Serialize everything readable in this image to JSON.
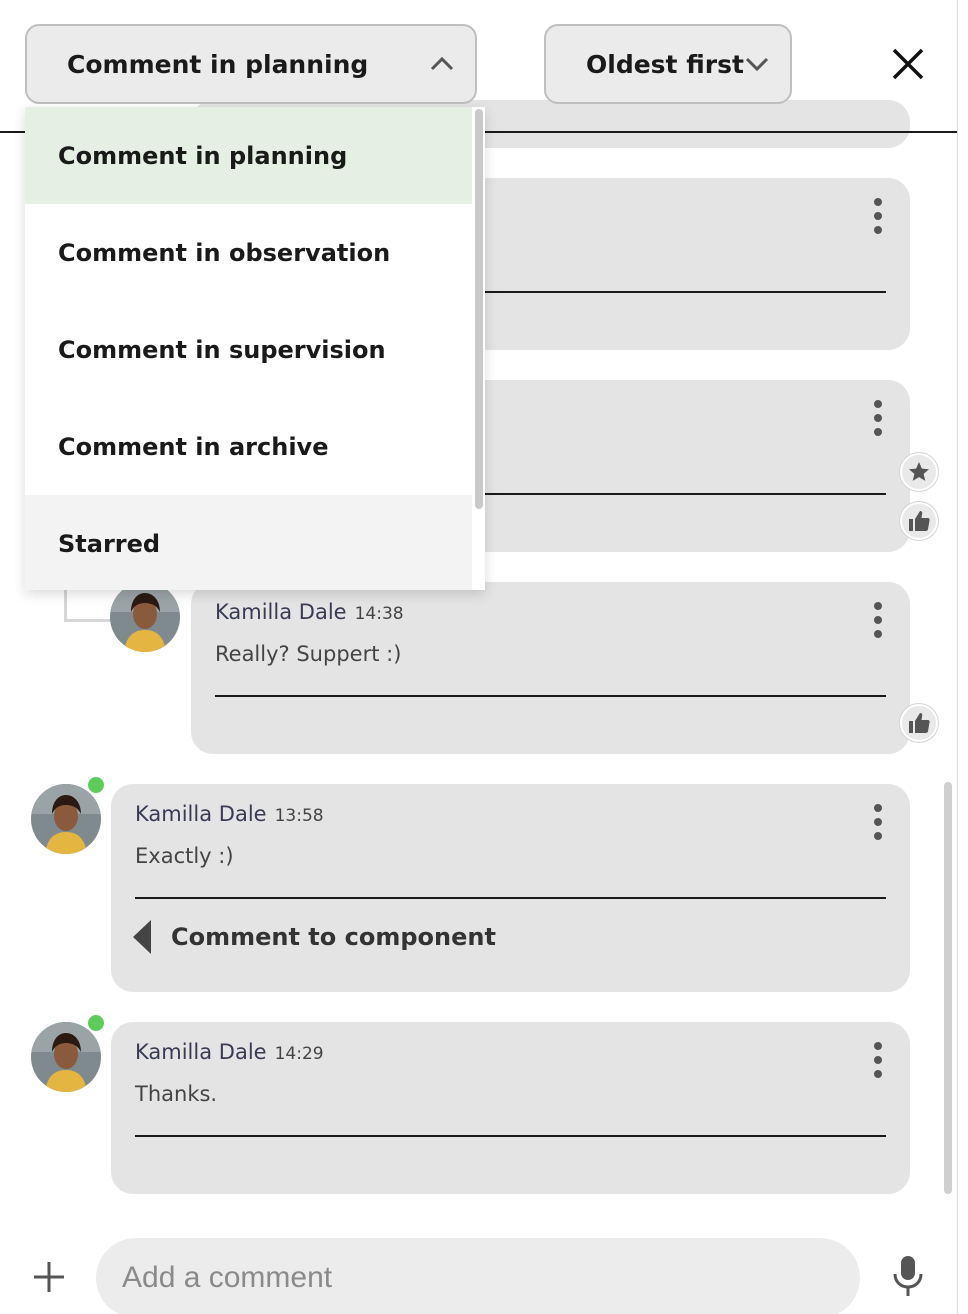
{
  "header": {
    "filter_label": "Comment in planning",
    "filter_chevron_icon": "chevron-up-icon",
    "sort_label": "Oldest first",
    "sort_chevron_icon": "chevron-down-icon",
    "close_icon": "close-icon"
  },
  "filter_dropdown": {
    "options": [
      {
        "label": "Comment in planning",
        "state": "selected"
      },
      {
        "label": "Comment in observation",
        "state": "default"
      },
      {
        "label": "Comment in supervision",
        "state": "default"
      },
      {
        "label": "Comment in archive",
        "state": "default"
      },
      {
        "label": "Starred",
        "state": "hover"
      }
    ]
  },
  "comments": [
    {
      "author": "Kamilla Dale",
      "time": "14:38",
      "text": "Really? Suppert :)",
      "is_reply": true,
      "reaction_icon": "thumbs-up-icon"
    },
    {
      "author": "Kamilla Dale",
      "time": "13:58",
      "text": "Exactly :)",
      "online": true,
      "reference": "Comment to component",
      "reference_icon": "triangle-left-icon"
    },
    {
      "author": "Kamilla Dale",
      "time": "14:29",
      "text": "Thanks.",
      "online": true
    }
  ],
  "hidden_card_reactions": [
    "star-icon",
    "thumbs-up-icon"
  ],
  "composer": {
    "placeholder": "Add a comment",
    "add_icon": "plus-icon",
    "mic_icon": "microphone-icon"
  },
  "colors": {
    "selected_option": "#e5efe4",
    "online_dot": "#5ccd5a",
    "card_background": "#e4e4e4"
  }
}
